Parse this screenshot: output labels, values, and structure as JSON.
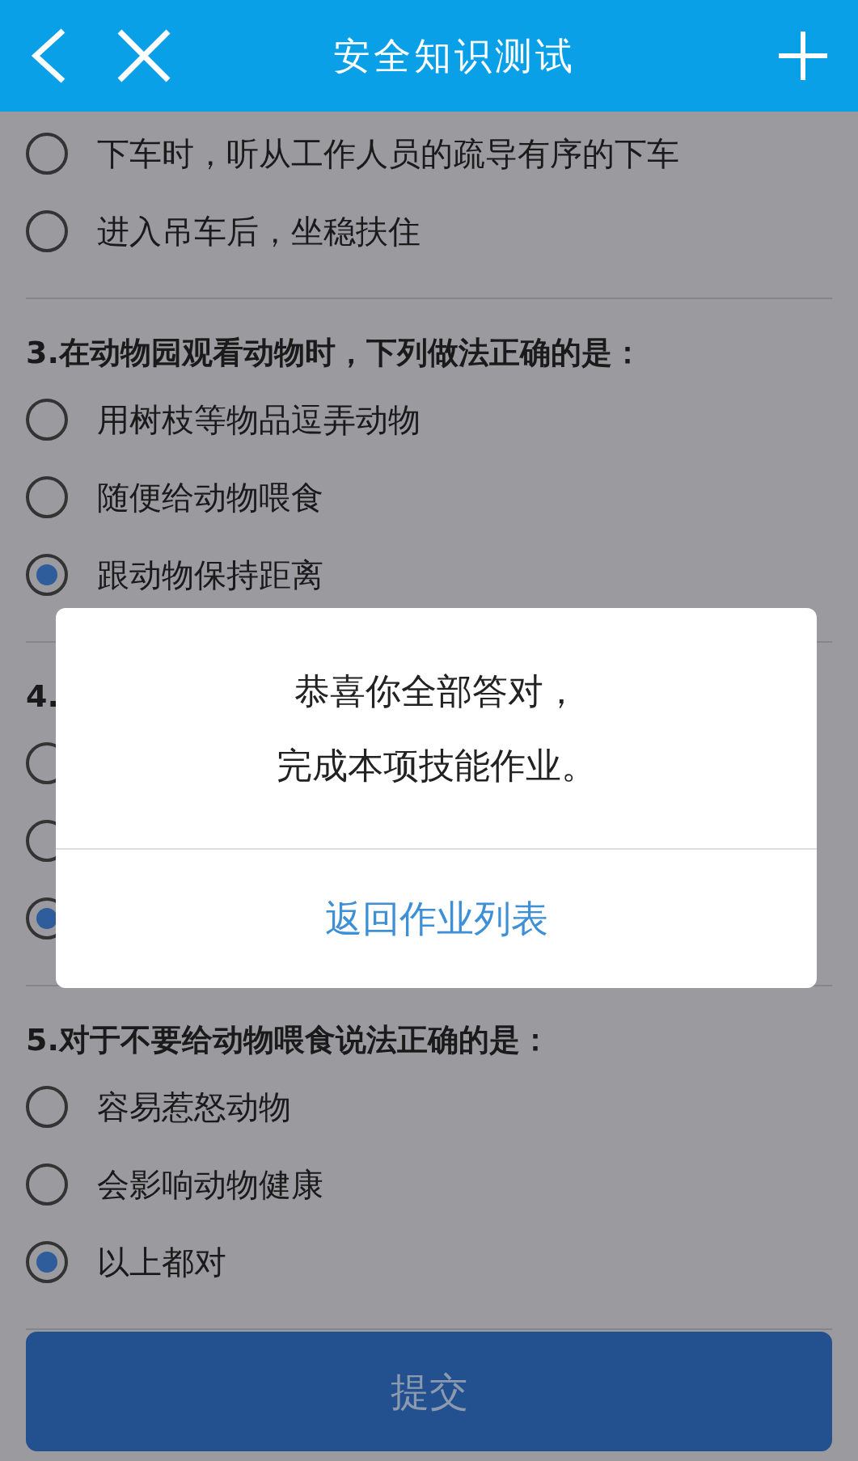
{
  "header": {
    "title": "安全知识测试"
  },
  "questions": [
    {
      "options": [
        {
          "label": "下车时，听从工作人员的疏导有序的下车",
          "selected": false
        },
        {
          "label": "进入吊车后，坐稳扶住",
          "selected": false
        }
      ]
    },
    {
      "title": "3.在动物园观看动物时，下列做法正确的是：",
      "options": [
        {
          "label": "用树枝等物品逗弄动物",
          "selected": false
        },
        {
          "label": "随便给动物喂食",
          "selected": false
        },
        {
          "label": "跟动物保持距离",
          "selected": true
        }
      ]
    },
    {
      "title": "4.",
      "options": [
        {
          "selected": false
        },
        {
          "selected": false
        },
        {
          "selected": true
        }
      ]
    },
    {
      "title": "5.对于不要给动物喂食说法正确的是：",
      "options": [
        {
          "label": "容易惹怒动物",
          "selected": false
        },
        {
          "label": "会影响动物健康",
          "selected": false
        },
        {
          "label": "以上都对",
          "selected": true
        }
      ]
    }
  ],
  "submit_button": "提交",
  "dialog": {
    "message_lines": [
      "恭喜你全部答对，",
      "完成本项技能作业。"
    ],
    "button": "返回作业列表"
  }
}
